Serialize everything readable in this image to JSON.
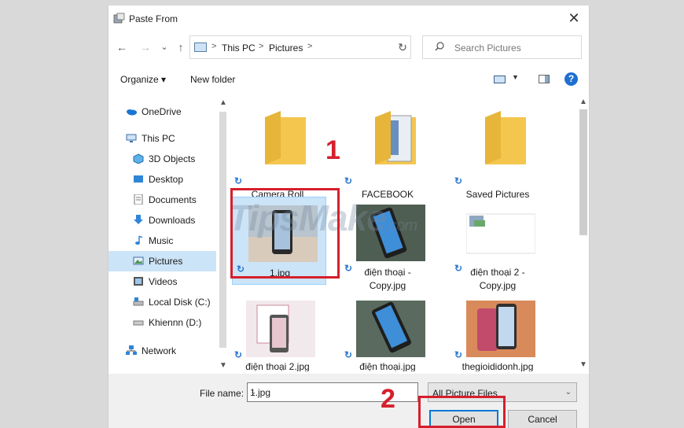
{
  "window": {
    "title": "Paste From",
    "close_symbol": "✕"
  },
  "nav": {
    "back": "←",
    "forward": "→",
    "recent": "⌄",
    "up": "↑",
    "breadcrumb": [
      "This PC",
      "Pictures"
    ],
    "refresh": "↻",
    "search_placeholder": "Search Pictures"
  },
  "toolbar": {
    "organize": "Organize ▾",
    "new_folder": "New folder",
    "help": "?"
  },
  "sidebar": {
    "items": [
      {
        "label": "OneDrive",
        "icon": "onedrive-icon"
      },
      {
        "label": "This PC",
        "icon": "computer-icon"
      },
      {
        "label": "3D Objects",
        "icon": "cube-icon"
      },
      {
        "label": "Desktop",
        "icon": "desktop-icon"
      },
      {
        "label": "Documents",
        "icon": "document-icon"
      },
      {
        "label": "Downloads",
        "icon": "download-icon"
      },
      {
        "label": "Music",
        "icon": "music-icon"
      },
      {
        "label": "Pictures",
        "icon": "pictures-icon",
        "selected": true
      },
      {
        "label": "Videos",
        "icon": "video-icon"
      },
      {
        "label": "Local Disk (C:)",
        "icon": "disk-icon"
      },
      {
        "label": "Khiennn (D:)",
        "icon": "drive-icon"
      },
      {
        "label": "Network",
        "icon": "network-icon"
      }
    ]
  },
  "files": [
    {
      "label": "Camera Roll",
      "kind": "folder"
    },
    {
      "label": "FACEBOOK",
      "kind": "folder-preview"
    },
    {
      "label": "Saved Pictures",
      "kind": "folder"
    },
    {
      "label": "1.jpg",
      "kind": "image",
      "selected": true
    },
    {
      "label": "điện thoại -\nCopy.jpg",
      "kind": "image"
    },
    {
      "label": "điện thoại 2 -\nCopy.jpg",
      "kind": "image"
    },
    {
      "label": "điện thoại 2.jpg",
      "kind": "image"
    },
    {
      "label": "điện thoại.jpg",
      "kind": "image"
    },
    {
      "label": "thegioididonh.jpg",
      "kind": "image"
    }
  ],
  "footer": {
    "filename_label": "File name:",
    "filename_value": "1.jpg",
    "filter_value": "All Picture Files",
    "open_label": "Open",
    "cancel_label": "Cancel"
  },
  "annotations": {
    "step1": "1",
    "step2": "2",
    "annotation_color": "#d61f2c"
  },
  "watermark": {
    "text": "TipsMake",
    "suffix": ".com"
  },
  "colors": {
    "selection": "#cce4f7",
    "accent": "#0078d7",
    "folder": "#f4c64e"
  }
}
